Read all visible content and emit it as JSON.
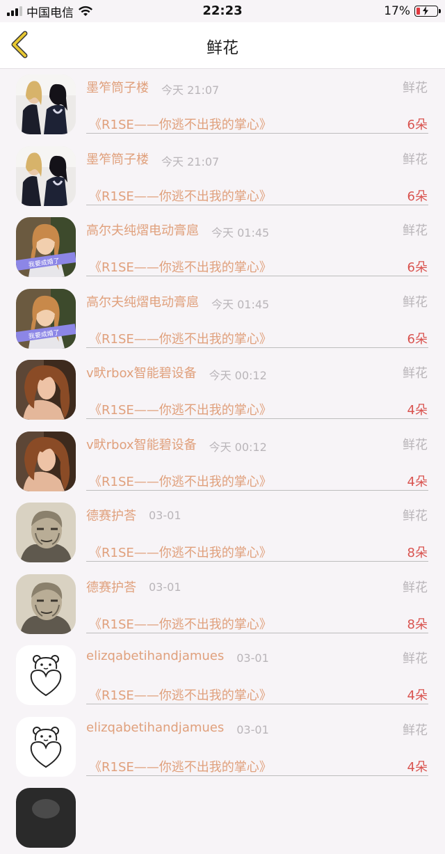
{
  "status_bar": {
    "carrier": "中国电信",
    "time": "22:23",
    "battery_percent": "17%",
    "battery_level": 0.17,
    "icons": [
      "signal-icon",
      "wifi-icon",
      "battery-charging-icon"
    ]
  },
  "navbar": {
    "title": "鲜花",
    "back_icon": "chevron-left-icon"
  },
  "colors": {
    "accent_name": "#e0a07c",
    "count_red": "#d9534f",
    "muted": "#b9b5b9",
    "back_yellow": "#e8c832"
  },
  "rows": [
    {
      "avatar": "two-girls-photo",
      "name": "墨笮筒子楼",
      "time": "今天 21:07",
      "gift": "鲜花",
      "song": "《R1SE——你逃不出我的掌心》",
      "count": "6朵"
    },
    {
      "avatar": "two-girls-photo",
      "name": "墨笮筒子楼",
      "time": "今天 21:07",
      "gift": "鲜花",
      "song": "《R1SE——你逃不出我的掌心》",
      "count": "6朵"
    },
    {
      "avatar": "blonde-girl-photo",
      "name": "高尔夫纯熠电动膏扈",
      "time": "今天 01:45",
      "gift": "鲜花",
      "song": "《R1SE——你逃不出我的掌心》",
      "count": "6朵"
    },
    {
      "avatar": "blonde-girl-photo",
      "name": "高尔夫纯熠电动膏扈",
      "time": "今天 01:45",
      "gift": "鲜花",
      "song": "《R1SE——你逃不出我的掌心》",
      "count": "6朵"
    },
    {
      "avatar": "brunette-photo",
      "name": "v畎rbox智能碧设备",
      "time": "今天 00:12",
      "gift": "鲜花",
      "song": "《R1SE——你逃不出我的掌心》",
      "count": "4朵"
    },
    {
      "avatar": "brunette-photo",
      "name": "v畎rbox智能碧设备",
      "time": "今天 00:12",
      "gift": "鲜花",
      "song": "《R1SE——你逃不出我的掌心》",
      "count": "4朵"
    },
    {
      "avatar": "old-man-sketch",
      "name": "德赛护荅",
      "time": "03-01",
      "gift": "鲜花",
      "song": "《R1SE——你逃不出我的掌心》",
      "count": "8朵"
    },
    {
      "avatar": "old-man-sketch",
      "name": "德赛护荅",
      "time": "03-01",
      "gift": "鲜花",
      "song": "《R1SE——你逃不出我的掌心》",
      "count": "8朵"
    },
    {
      "avatar": "bear-heart-icon",
      "name": "elizqabetihandjamues",
      "time": "03-01",
      "gift": "鲜花",
      "song": "《R1SE——你逃不出我的掌心》",
      "count": "4朵"
    },
    {
      "avatar": "bear-heart-icon",
      "name": "elizqabetihandjamues",
      "time": "03-01",
      "gift": "鲜花",
      "song": "《R1SE——你逃不出我的掌心》",
      "count": "4朵"
    },
    {
      "avatar": "dark-photo",
      "name": "",
      "time": "",
      "gift": "",
      "song": "",
      "count": ""
    }
  ]
}
